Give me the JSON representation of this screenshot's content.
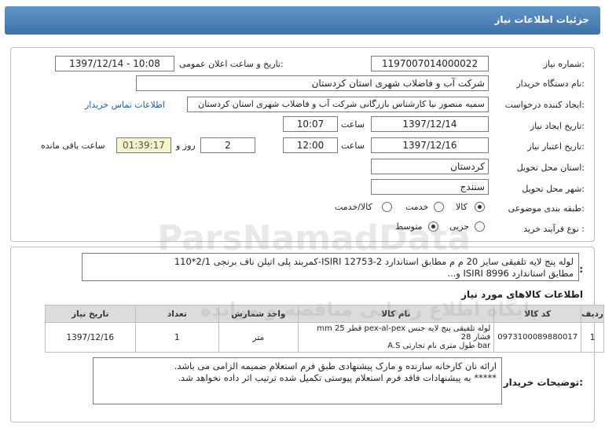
{
  "header": {
    "title": "جزئیات اطلاعات نیاز"
  },
  "form": {
    "need_number_label": "شماره نیاز:",
    "need_number": "1197007014000022",
    "announce_label": "تاریخ و ساعت اعلان عمومی:",
    "announce_value": "1397/12/14 - 10:08",
    "buyer_org_label": "نام دستگاه خریدار:",
    "buyer_org": "شرکت آب و فاضلاب شهری استان کردستان",
    "creator_label": "ایجاد کننده درخواست:",
    "creator": "سمیه منصور نیا کارشناس بازرگانی شرکت آب و فاضلاب شهری استان کردستان",
    "contact_link": "اطلاعات تماس خریدار",
    "created_date_label": "تاریخ ایجاد نیاز:",
    "created_date": "1397/12/14",
    "time_label": "ساعت",
    "created_time": "10:07",
    "validity_label": "تاریخ اعتبار نیاز:",
    "validity_date": "1397/12/16",
    "validity_time": "12:00",
    "days_value": "2",
    "days_label": "روز و",
    "remaining_time": "01:39:17",
    "remaining_label": "ساعت باقی مانده",
    "province_label": "استان محل تحویل:",
    "province": "کردستان",
    "city_label": "شهر محل تحویل:",
    "city": "سنندج",
    "category_label": "طبقه بندی موضوعی:",
    "category_options": [
      "کالا",
      "خدمت",
      "کالا/خدمت"
    ],
    "process_label": "نوع فرآیند خرید :",
    "process_options": [
      "جزیی",
      "متوسط"
    ]
  },
  "general": {
    "label": "شرح کلی نیاز:",
    "text_line1": "لوله پنج لایه تلفیقی سایز 20 م م مطابق استاندارد ISIRI 12753-2-کمربند پلی اتیلن ناف برنجی 2/1*110",
    "text_line2": "مطابق استاندارد ISIRI 8996 و..."
  },
  "items": {
    "title": "اطلاعات کالاهای مورد نیاز",
    "headers": [
      "ردیف",
      "کد کالا",
      "نام کالا",
      "واحد شمارش",
      "تعداد",
      "تاریخ نیاز"
    ],
    "rows": [
      {
        "row": "1",
        "code": "0973100089880017",
        "name_line1": "لوله تلفیقی پنج لایه جنس pex-al-pex قطر 25 mm فشار 28",
        "name_line2": "bar طول متری نام تجارتی A.S",
        "unit": "متر",
        "qty": "1",
        "date": "1397/12/16"
      }
    ]
  },
  "buyer_notes": {
    "label": "توضیحات خریدار:",
    "line1": "ارائه نان کارخانه سازنده و مارک پیشنهادی طبق فرم استعلام ضمیمه الزامی می باشد.",
    "line2": "***** به پیشنهادات فاقد فرم استعلام پیوستی تکمیل شده ترتیب اثر داده نخواهد شد."
  },
  "watermark": {
    "latin": "ParsNamadData",
    "persian": "پایگاه اطلاع رسانی مناقصه و مزایده"
  }
}
